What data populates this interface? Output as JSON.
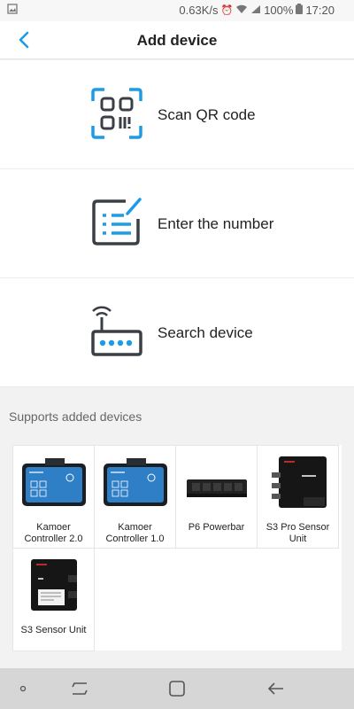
{
  "status_bar": {
    "speed": "0.63K/s",
    "battery": "100%",
    "time": "17:20"
  },
  "header": {
    "title": "Add device",
    "back_icon": "chevron-left-icon"
  },
  "menu": [
    {
      "label": "Scan QR code",
      "icon": "qr-scan-icon"
    },
    {
      "label": "Enter the number",
      "icon": "edit-form-icon"
    },
    {
      "label": "Search device",
      "icon": "router-search-icon"
    }
  ],
  "supported": {
    "title": "Supports added devices",
    "devices": [
      {
        "name": "Kamoer Controller 2.0"
      },
      {
        "name": "Kamoer Controller 1.0"
      },
      {
        "name": "P6 Powerbar"
      },
      {
        "name": "S3 Pro Sensor Unit"
      },
      {
        "name": "S3 Sensor Unit"
      }
    ]
  },
  "colors": {
    "accent": "#1e9be6",
    "dark_icon": "#3a3f45"
  }
}
